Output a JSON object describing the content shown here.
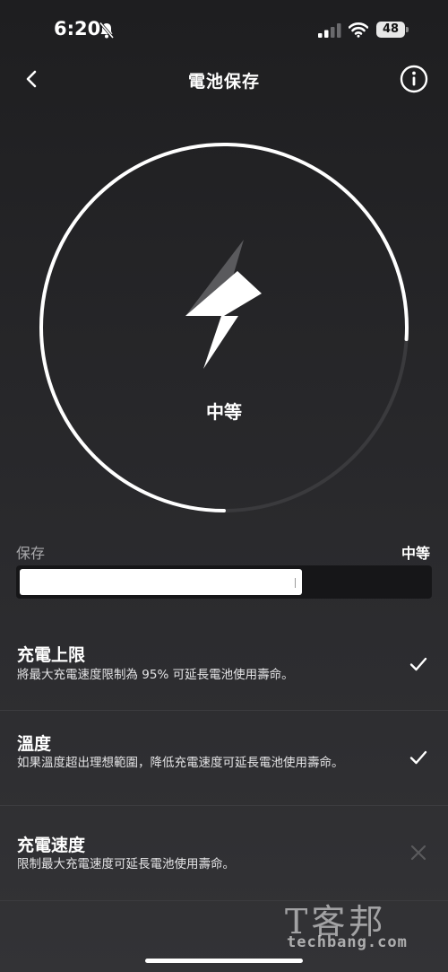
{
  "status_bar": {
    "time": "6:20",
    "battery_level": "48",
    "silent_icon": "bell-slash-icon",
    "signal_icon": "cellular-signal-icon",
    "wifi_icon": "wifi-icon"
  },
  "nav": {
    "back_icon": "chevron-left-icon",
    "title": "電池保存",
    "info_icon": "info-circle-icon"
  },
  "gauge": {
    "icon": "lightning-bolt-icon",
    "label": "中等",
    "progress": 0.76
  },
  "save": {
    "label": "保存",
    "value": "中等",
    "fill": 0.69
  },
  "options": [
    {
      "title": "充電上限",
      "description": "將最大充電速度限制為 95% 可延長電池使用壽命。",
      "enabled": true
    },
    {
      "title": "溫度",
      "description": "如果溫度超出理想範圍，降低充電速度可延長電池使用壽命。",
      "enabled": true
    },
    {
      "title": "充電速度",
      "description": "限制最大充電速度可延長電池使用壽命。",
      "enabled": false
    }
  ],
  "watermark": {
    "logo": "T客邦",
    "site": "techbang.com"
  },
  "colors": {
    "background": "#1e1e20",
    "accent": "#ffffff",
    "track": "#3a3a3d",
    "disabled": "#5a5a5d"
  }
}
